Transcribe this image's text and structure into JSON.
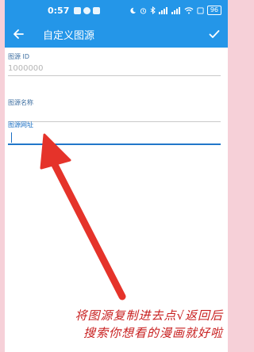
{
  "status_bar": {
    "time": "0:57",
    "battery": "96"
  },
  "app_bar": {
    "title": "自定义图源",
    "back_icon": "arrow-left-icon",
    "confirm_icon": "check-icon"
  },
  "form": {
    "fields": [
      {
        "label": "图源 ID",
        "placeholder": "1000000",
        "value": ""
      },
      {
        "label": "图源名称",
        "placeholder": "",
        "value": ""
      },
      {
        "label": "图源网址",
        "placeholder": "",
        "value": ""
      }
    ]
  },
  "annotation": {
    "line1": "将图源复制进去点√返回后",
    "line2": "搜索你想看的漫画就好啦",
    "color": "#e5332a"
  },
  "colors": {
    "primary": "#2496e8",
    "background_edge": "#f6d0d8"
  }
}
